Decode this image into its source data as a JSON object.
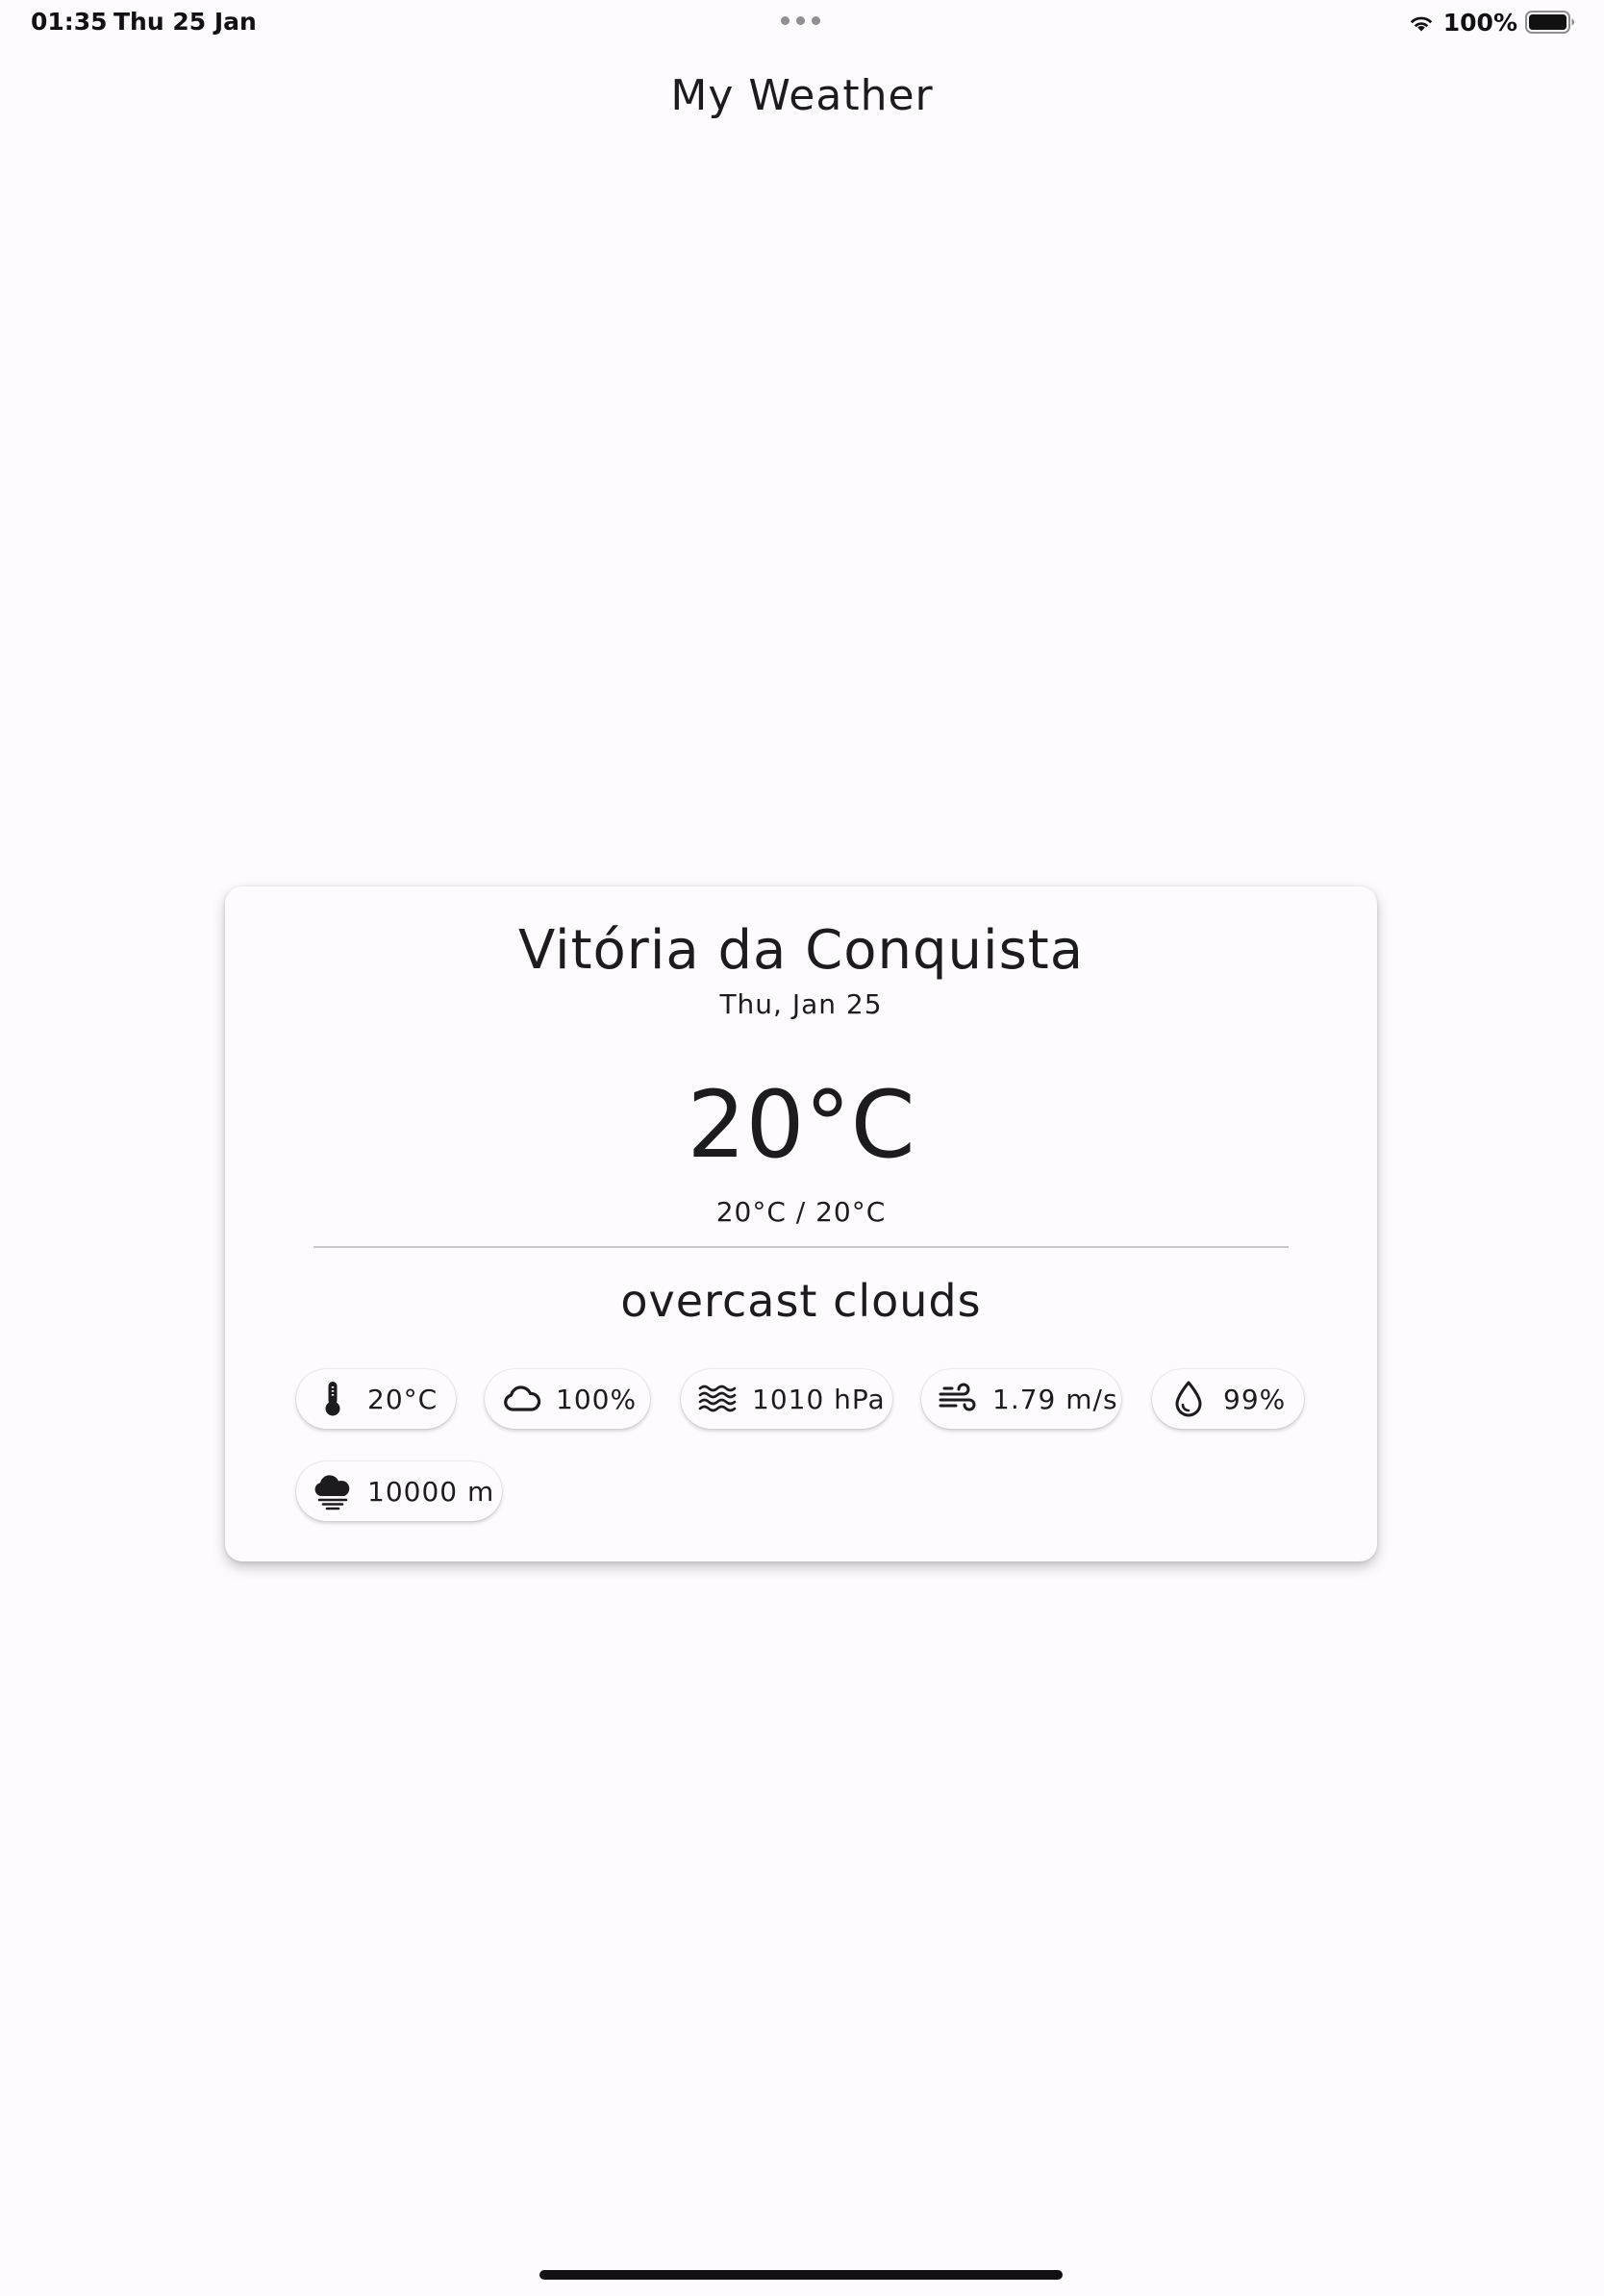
{
  "status_bar": {
    "time": "01:35",
    "date": "Thu 25 Jan",
    "battery": "100%"
  },
  "app_bar": {
    "title": "My Weather"
  },
  "weather": {
    "city": "Vitória da Conquista",
    "date": "Thu, Jan 25",
    "temperature": "20°C",
    "min_max": "20°C / 20°C",
    "condition": "overcast clouds",
    "details": {
      "feels_like": "20°C",
      "clouds": "100%",
      "pressure": "1010 hPa",
      "wind": "1.79 m/s",
      "humidity": "99%",
      "visibility": "10000 m"
    }
  },
  "icons": {
    "feels_like": "thermometer-icon",
    "clouds": "cloud-icon",
    "pressure": "waves-icon",
    "wind": "wind-icon",
    "humidity": "water-drop-icon",
    "visibility": "fog-cloud-icon"
  },
  "colors": {
    "background": "#fefbfe",
    "text": "#1c1b1f",
    "divider": "#c9c5ca"
  }
}
